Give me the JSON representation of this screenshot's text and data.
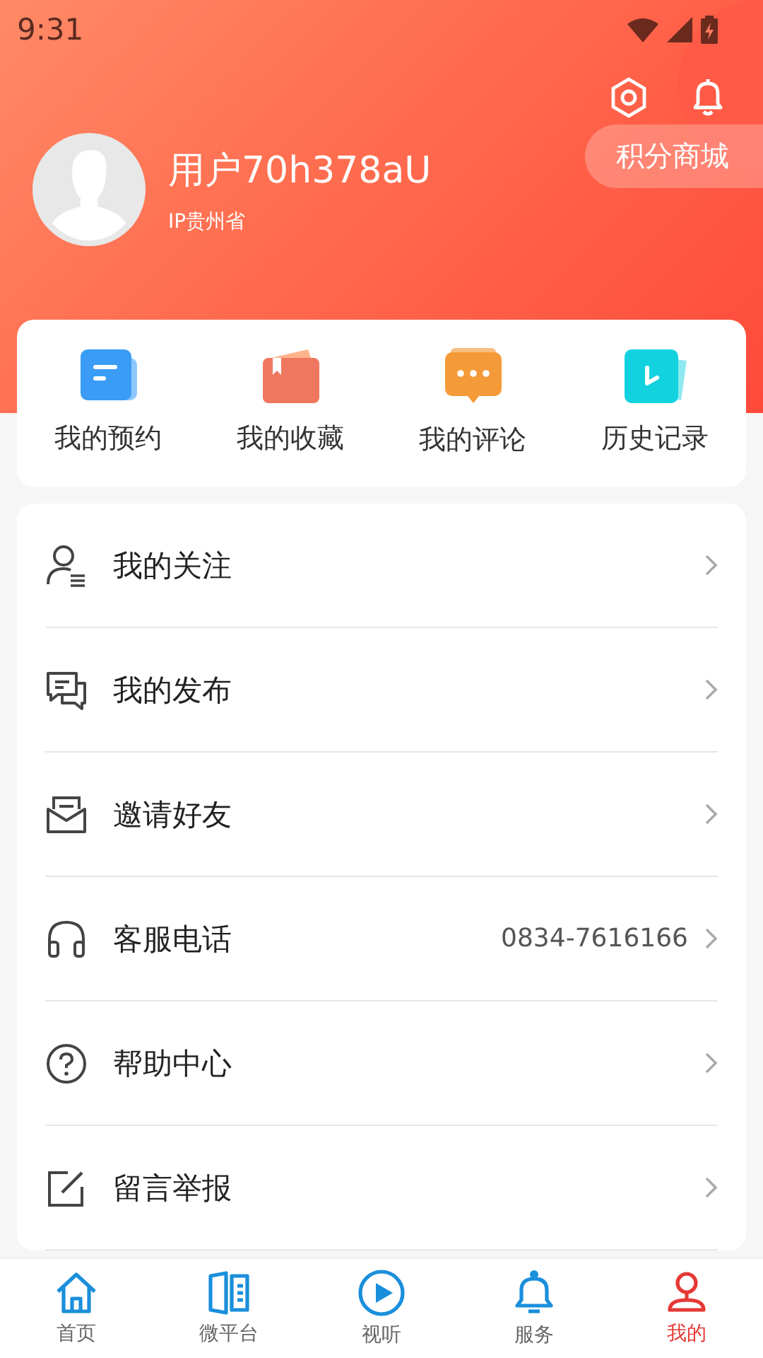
{
  "status_bar": {
    "time": "9:31"
  },
  "profile": {
    "username": "用户70h378aU",
    "location": "IP贵州省",
    "points_button": "积分商城"
  },
  "shortcuts": [
    {
      "label": "我的预约"
    },
    {
      "label": "我的收藏"
    },
    {
      "label": "我的评论"
    },
    {
      "label": "历史记录"
    }
  ],
  "menu": [
    {
      "label": "我的关注"
    },
    {
      "label": "我的发布"
    },
    {
      "label": "邀请好友"
    },
    {
      "label": "客服电话",
      "value": "0834-7616166"
    },
    {
      "label": "帮助中心"
    },
    {
      "label": "留言举报"
    }
  ],
  "bottom_nav": [
    {
      "label": "首页",
      "selected": false
    },
    {
      "label": "微平台",
      "selected": false
    },
    {
      "label": "视听",
      "selected": false
    },
    {
      "label": "服务",
      "selected": false
    },
    {
      "label": "我的",
      "selected": true
    }
  ]
}
